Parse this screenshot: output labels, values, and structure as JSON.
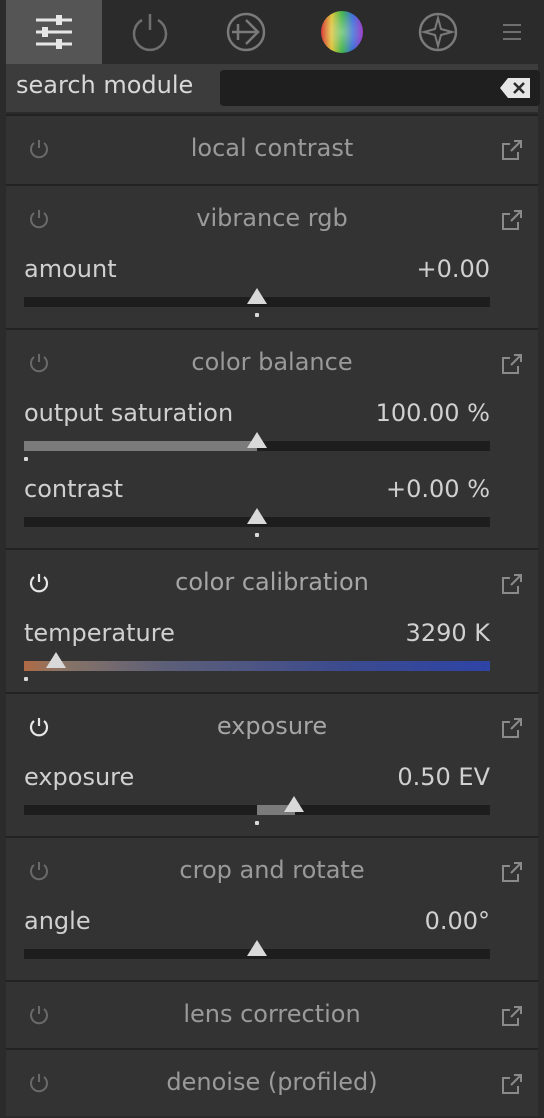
{
  "tabs": [
    {
      "icon": "sliders-icon",
      "active": true
    },
    {
      "icon": "power-icon",
      "active": false
    },
    {
      "icon": "shutter-icon",
      "active": false
    },
    {
      "icon": "color-wheel-icon",
      "active": false
    },
    {
      "icon": "sparkle-icon",
      "active": false
    },
    {
      "icon": "menu-icon",
      "active": false
    }
  ],
  "search": {
    "label": "search module",
    "value": ""
  },
  "modules": [
    {
      "title": "local contrast",
      "enabled": false,
      "sliders": []
    },
    {
      "title": "vibrance rgb",
      "enabled": false,
      "sliders": [
        {
          "label": "amount",
          "value": "+0.00",
          "position": 0.5
        }
      ]
    },
    {
      "title": "color balance",
      "enabled": false,
      "sliders": [
        {
          "label": "output saturation",
          "value": "100.00 %",
          "position": 0.5
        },
        {
          "label": "contrast",
          "value": "+0.00 %",
          "position": 0.5
        }
      ]
    },
    {
      "title": "color calibration",
      "enabled": true,
      "sliders": [
        {
          "label": "temperature",
          "value": "3290 K",
          "position": 0.07
        }
      ]
    },
    {
      "title": "exposure",
      "enabled": true,
      "sliders": [
        {
          "label": "exposure",
          "value": "0.50 EV",
          "position": 0.58
        }
      ]
    },
    {
      "title": "crop and rotate",
      "enabled": false,
      "sliders": [
        {
          "label": "angle",
          "value": "0.00°",
          "position": 0.5
        }
      ]
    },
    {
      "title": "lens correction",
      "enabled": false,
      "sliders": []
    },
    {
      "title": "denoise (profiled)",
      "enabled": false,
      "sliders": []
    }
  ],
  "colors": {
    "background": "#2b2b2b",
    "module": "#333333",
    "active_tab": "#555555"
  }
}
